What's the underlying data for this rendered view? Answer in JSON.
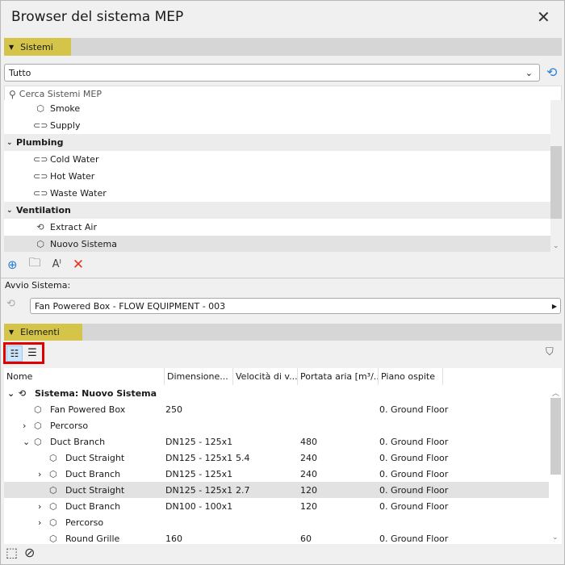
{
  "window": {
    "title": "Browser del sistema MEP",
    "close_icon": "close-icon"
  },
  "sistemi": {
    "header": "Sistemi",
    "filter_value": "Tutto",
    "search_placeholder": "Cerca Sistemi MEP",
    "list": [
      {
        "type": "item",
        "label": "Smoke",
        "icon": "duct-system-icon"
      },
      {
        "type": "item",
        "label": "Supply",
        "icon": "pipe-system-icon"
      },
      {
        "type": "group",
        "label": "Plumbing"
      },
      {
        "type": "item",
        "label": "Cold Water",
        "icon": "pipe-system-icon"
      },
      {
        "type": "item",
        "label": "Hot Water",
        "icon": "pipe-system-icon"
      },
      {
        "type": "item",
        "label": "Waste Water",
        "icon": "pipe-system-icon"
      },
      {
        "type": "group",
        "label": "Ventilation"
      },
      {
        "type": "item",
        "label": "Extract Air",
        "icon": "system-link-icon"
      },
      {
        "type": "item",
        "label": "Nuovo Sistema",
        "icon": "duct-system-icon",
        "selected": true
      }
    ]
  },
  "avvio": {
    "label": "Avvio Sistema:",
    "value": "Fan Powered Box - FLOW EQUIPMENT - 003"
  },
  "elementi": {
    "header": "Elementi",
    "columns": [
      "Nome",
      "Dimensione...",
      "Velocità di v...",
      "Portata aria [m³/...",
      "Piano ospite"
    ],
    "rows": [
      {
        "indent": 0,
        "expander": "open",
        "bold": true,
        "name": "Sistema: Nuovo Sistema",
        "dim": "",
        "vel": "",
        "port": "",
        "piano": ""
      },
      {
        "indent": 1,
        "expander": "",
        "name": "Fan Powered Box",
        "dim": "250",
        "vel": "",
        "port": "",
        "piano": "0. Ground Floor"
      },
      {
        "indent": 1,
        "expander": "closed",
        "name": "Percorso",
        "dim": "",
        "vel": "",
        "port": "",
        "piano": ""
      },
      {
        "indent": 1,
        "expander": "open",
        "name": "Duct Branch",
        "dim": "DN125 - 125x1",
        "vel": "",
        "port": "480",
        "piano": "0. Ground Floor"
      },
      {
        "indent": 2,
        "expander": "",
        "name": "Duct Straight",
        "dim": "DN125 - 125x1",
        "vel": "5.4",
        "port": "240",
        "piano": "0. Ground Floor"
      },
      {
        "indent": 2,
        "expander": "closed",
        "name": "Duct Branch",
        "dim": "DN125 - 125x1",
        "vel": "",
        "port": "240",
        "piano": "0. Ground Floor"
      },
      {
        "indent": 2,
        "expander": "",
        "name": "Duct Straight",
        "dim": "DN125 - 125x1",
        "vel": "2.7",
        "port": "120",
        "piano": "0. Ground Floor",
        "selected": true
      },
      {
        "indent": 2,
        "expander": "closed",
        "name": "Duct Branch",
        "dim": "DN100 - 100x1",
        "vel": "",
        "port": "120",
        "piano": "0. Ground Floor"
      },
      {
        "indent": 2,
        "expander": "closed",
        "name": "Percorso",
        "dim": "",
        "vel": "",
        "port": "",
        "piano": ""
      },
      {
        "indent": 2,
        "expander": "",
        "name": "Round Grille",
        "dim": "160",
        "vel": "",
        "port": "60",
        "piano": "0. Ground Floor"
      }
    ]
  },
  "colors": {
    "section_highlight": "#d4c44a",
    "selection": "#e2e2e2",
    "delete": "#e8321e",
    "accent": "#2a7fd4",
    "annotation_box": "#e00000"
  }
}
